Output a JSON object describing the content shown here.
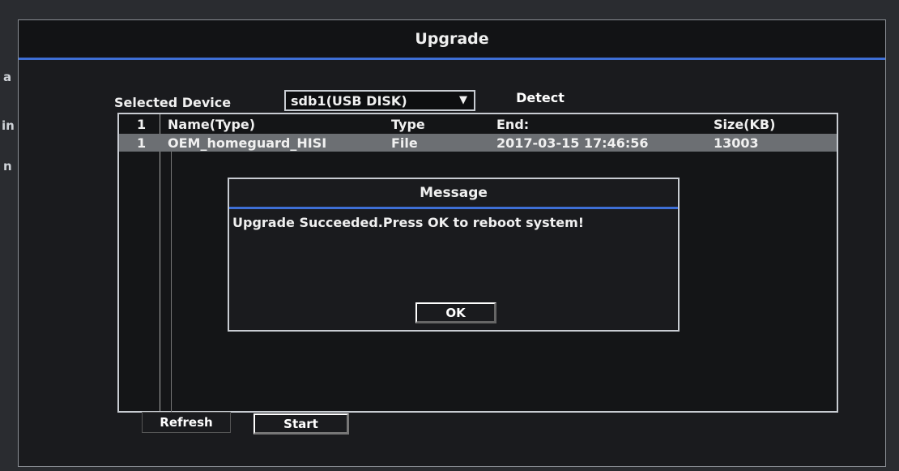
{
  "background_fragments": [
    "a",
    "in",
    "n"
  ],
  "window": {
    "title": "Upgrade",
    "selected_device_label": "Selected Device",
    "device_value": "sdb1(USB DISK)",
    "detect_label": "Detect",
    "refresh_label": "Refresh",
    "start_label": "Start"
  },
  "file_list": {
    "header": {
      "index": "1",
      "name": "Name(Type)",
      "type": "Type",
      "end": "End:",
      "size": "Size(KB)"
    },
    "rows": [
      {
        "index": "1",
        "name": "OEM_homeguard_HISI",
        "type": "File",
        "end": "2017-03-15 17:46:56",
        "size": "13003"
      }
    ]
  },
  "dialog": {
    "title": "Message",
    "message": "Upgrade Succeeded.Press OK to reboot system!",
    "ok_label": "OK"
  },
  "colors": {
    "accent": "#3e6fd6",
    "selected_row": "#6c6f73"
  },
  "icons": {
    "dropdown": "chevron-down-icon"
  }
}
